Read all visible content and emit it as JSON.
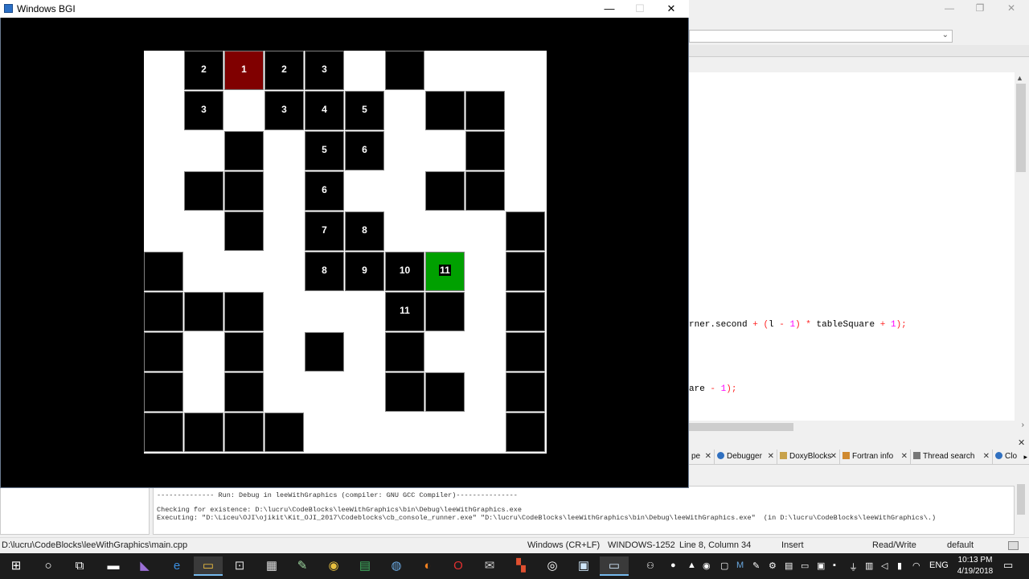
{
  "ide": {
    "code_lines": [
      {
        "text": "rner.second + (l - 1) * tableSquare + 1);"
      },
      {
        "text": "are - 1);"
      }
    ],
    "log_tabs": [
      "pe",
      "Debugger",
      "DoxyBlocks",
      "Fortran info",
      "Thread search",
      "Clo"
    ],
    "log_lines": [
      "-------------- Run: Debug in leeWithGraphics (compiler: GNU GCC Compiler)---------------",
      "Checking for existence: D:\\lucru\\CodeBlocks\\leeWithGraphics\\bin\\Debug\\leeWithGraphics.exe",
      "Executing: \"D:\\Liceu\\OJI\\ojikit\\Kit_OJI_2017\\Codeblocks\\cb_console_runner.exe\" \"D:\\lucru\\CodeBlocks\\leeWithGraphics\\bin\\Debug\\leeWithGraphics.exe\"  (in D:\\lucru\\CodeBlocks\\leeWithGraphics\\.)"
    ],
    "status": {
      "file_path": "D:\\lucru\\CodeBlocks\\leeWithGraphics\\main.cpp",
      "line_endings": "Windows (CR+LF)",
      "encoding": "WINDOWS-1252",
      "position": "Line 8, Column 34",
      "mode": "Insert",
      "access": "Read/Write",
      "profile": "default"
    }
  },
  "bgi_window": {
    "title": "Windows BGI",
    "buttons": {
      "minimize": "—",
      "maximize": "☐",
      "close": "✕"
    }
  },
  "grid": {
    "rows": 10,
    "cols": 10,
    "colors": {
      "wall": "#000000",
      "start": "#800000",
      "end": "#00a000",
      "free": "#ffffff"
    },
    "cells": [
      [
        "free",
        "wall",
        "start",
        "wall",
        "wall",
        "free",
        "wall",
        "free",
        "free",
        "free"
      ],
      [
        "free",
        "wall",
        "free",
        "wall",
        "wall",
        "wall",
        "free",
        "wall",
        "wall",
        "free"
      ],
      [
        "free",
        "free",
        "wall",
        "free",
        "wall",
        "wall",
        "free",
        "free",
        "wall",
        "free"
      ],
      [
        "free",
        "wall",
        "wall",
        "free",
        "wall",
        "free",
        "free",
        "wall",
        "wall",
        "free"
      ],
      [
        "free",
        "free",
        "wall",
        "free",
        "wall",
        "wall",
        "free",
        "free",
        "free",
        "wall"
      ],
      [
        "wall",
        "free",
        "free",
        "free",
        "wall",
        "wall",
        "wall",
        "end",
        "free",
        "wall"
      ],
      [
        "wall",
        "wall",
        "wall",
        "free",
        "free",
        "free",
        "wall",
        "wall",
        "free",
        "wall"
      ],
      [
        "wall",
        "free",
        "wall",
        "free",
        "wall",
        "free",
        "wall",
        "free",
        "free",
        "wall"
      ],
      [
        "wall",
        "free",
        "wall",
        "free",
        "free",
        "free",
        "wall",
        "wall",
        "free",
        "wall"
      ],
      [
        "wall",
        "wall",
        "wall",
        "wall",
        "free",
        "free",
        "free",
        "free",
        "free",
        "wall"
      ]
    ],
    "labels": [
      [
        "",
        "2",
        "1",
        "2",
        "3",
        "",
        "",
        "",
        "",
        ""
      ],
      [
        "",
        "3",
        "",
        "3",
        "4",
        "5",
        "",
        "",
        "",
        ""
      ],
      [
        "",
        "",
        "",
        "",
        "5",
        "6",
        "",
        "",
        "",
        ""
      ],
      [
        "",
        "",
        "",
        "",
        "6",
        "",
        "",
        "",
        "",
        ""
      ],
      [
        "",
        "",
        "",
        "",
        "7",
        "8",
        "",
        "",
        "",
        ""
      ],
      [
        "",
        "",
        "",
        "",
        "8",
        "9",
        "10",
        "11",
        "",
        ""
      ],
      [
        "",
        "",
        "",
        "",
        "",
        "",
        "11",
        "",
        "",
        ""
      ],
      [
        "",
        "",
        "",
        "",
        "",
        "",
        "",
        "",
        "",
        ""
      ],
      [
        "",
        "",
        "",
        "",
        "",
        "",
        "",
        "",
        "",
        ""
      ],
      [
        "",
        "",
        "",
        "",
        "",
        "",
        "",
        "",
        "",
        ""
      ]
    ]
  },
  "taskbar": {
    "apps": [
      "windows-start",
      "cortana",
      "task-view",
      "terminal",
      "visual-studio",
      "edge",
      "file-explorer",
      "store",
      "calculator",
      "notepadpp",
      "chrome",
      "excel",
      "thunderbird",
      "firefox",
      "opera",
      "mail",
      "codeblocks-app",
      "obs",
      "notepad",
      "bgi-window"
    ],
    "tray_language": "ENG",
    "time": "10:13 PM",
    "date": "4/19/2018"
  }
}
